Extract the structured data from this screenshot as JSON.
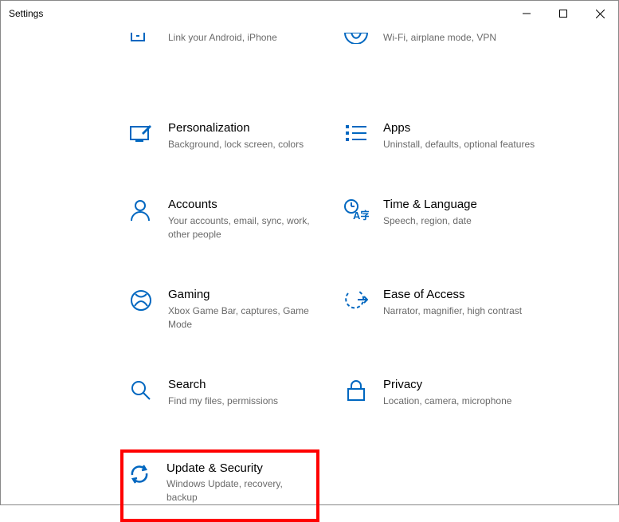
{
  "window": {
    "title": "Settings"
  },
  "tiles": {
    "phone": {
      "title": "",
      "sub": "Link your Android, iPhone"
    },
    "network": {
      "title": "",
      "sub": "Wi-Fi, airplane mode, VPN"
    },
    "personalization": {
      "title": "Personalization",
      "sub": "Background, lock screen, colors"
    },
    "apps": {
      "title": "Apps",
      "sub": "Uninstall, defaults, optional features"
    },
    "accounts": {
      "title": "Accounts",
      "sub": "Your accounts, email, sync, work, other people"
    },
    "time": {
      "title": "Time & Language",
      "sub": "Speech, region, date"
    },
    "gaming": {
      "title": "Gaming",
      "sub": "Xbox Game Bar, captures, Game Mode"
    },
    "ease": {
      "title": "Ease of Access",
      "sub": "Narrator, magnifier, high contrast"
    },
    "search": {
      "title": "Search",
      "sub": "Find my files, permissions"
    },
    "privacy": {
      "title": "Privacy",
      "sub": "Location, camera, microphone"
    },
    "update": {
      "title": "Update & Security",
      "sub": "Windows Update, recovery, backup"
    }
  }
}
